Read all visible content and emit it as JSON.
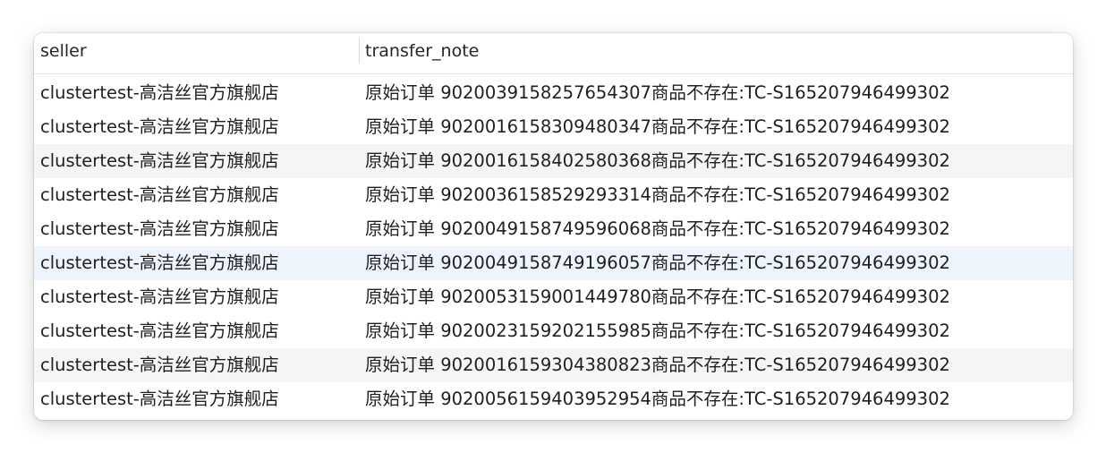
{
  "table": {
    "columns": [
      "seller",
      "transfer_note"
    ],
    "rows": [
      {
        "seller": "clustertest-高洁丝官方旗舰店",
        "transfer_note": "原始订单 902003915825765430​7商品不存在:TC-S165207946499302"
      },
      {
        "seller": "clustertest-高洁丝官方旗舰店",
        "transfer_note": "原始订单 902001615830948034​7商品不存在:TC-S165207946499302"
      },
      {
        "seller": "clustertest-高洁丝官方旗舰店",
        "transfer_note": "原始订单 902001615840258036​8商品不存在:TC-S165207946499302"
      },
      {
        "seller": "clustertest-高洁丝官方旗舰店",
        "transfer_note": "原始订单 902003615852929331​4商品不存在:TC-S165207946499302"
      },
      {
        "seller": "clustertest-高洁丝官方旗舰店",
        "transfer_note": "原始订单 902004915874959606​8商品不存在:TC-S165207946499302"
      },
      {
        "seller": "clustertest-高洁丝官方旗舰店",
        "transfer_note": "原始订单 902004915874919605​7商品不存在:TC-S165207946499302"
      },
      {
        "seller": "clustertest-高洁丝官方旗舰店",
        "transfer_note": "原始订单 902005315900144978​0商品不存在:TC-S165207946499302"
      },
      {
        "seller": "clustertest-高洁丝官方旗舰店",
        "transfer_note": "原始订单 902002315920215598​5商品不存在:TC-S165207946499302"
      },
      {
        "seller": "clustertest-高洁丝官方旗舰店",
        "transfer_note": "原始订单 902001615930438082​3商品不存在:TC-S165207946499302"
      },
      {
        "seller": "clustertest-高洁丝官方旗舰店",
        "transfer_note": "原始订单 902005615940395295​4商品不存在:TC-S165207946499302"
      }
    ]
  },
  "colors": {
    "alt_row": "#f5f5f5",
    "hover_row": "#eef4fc",
    "text": "#1f1f1f",
    "divider": "#d6d6d6"
  }
}
